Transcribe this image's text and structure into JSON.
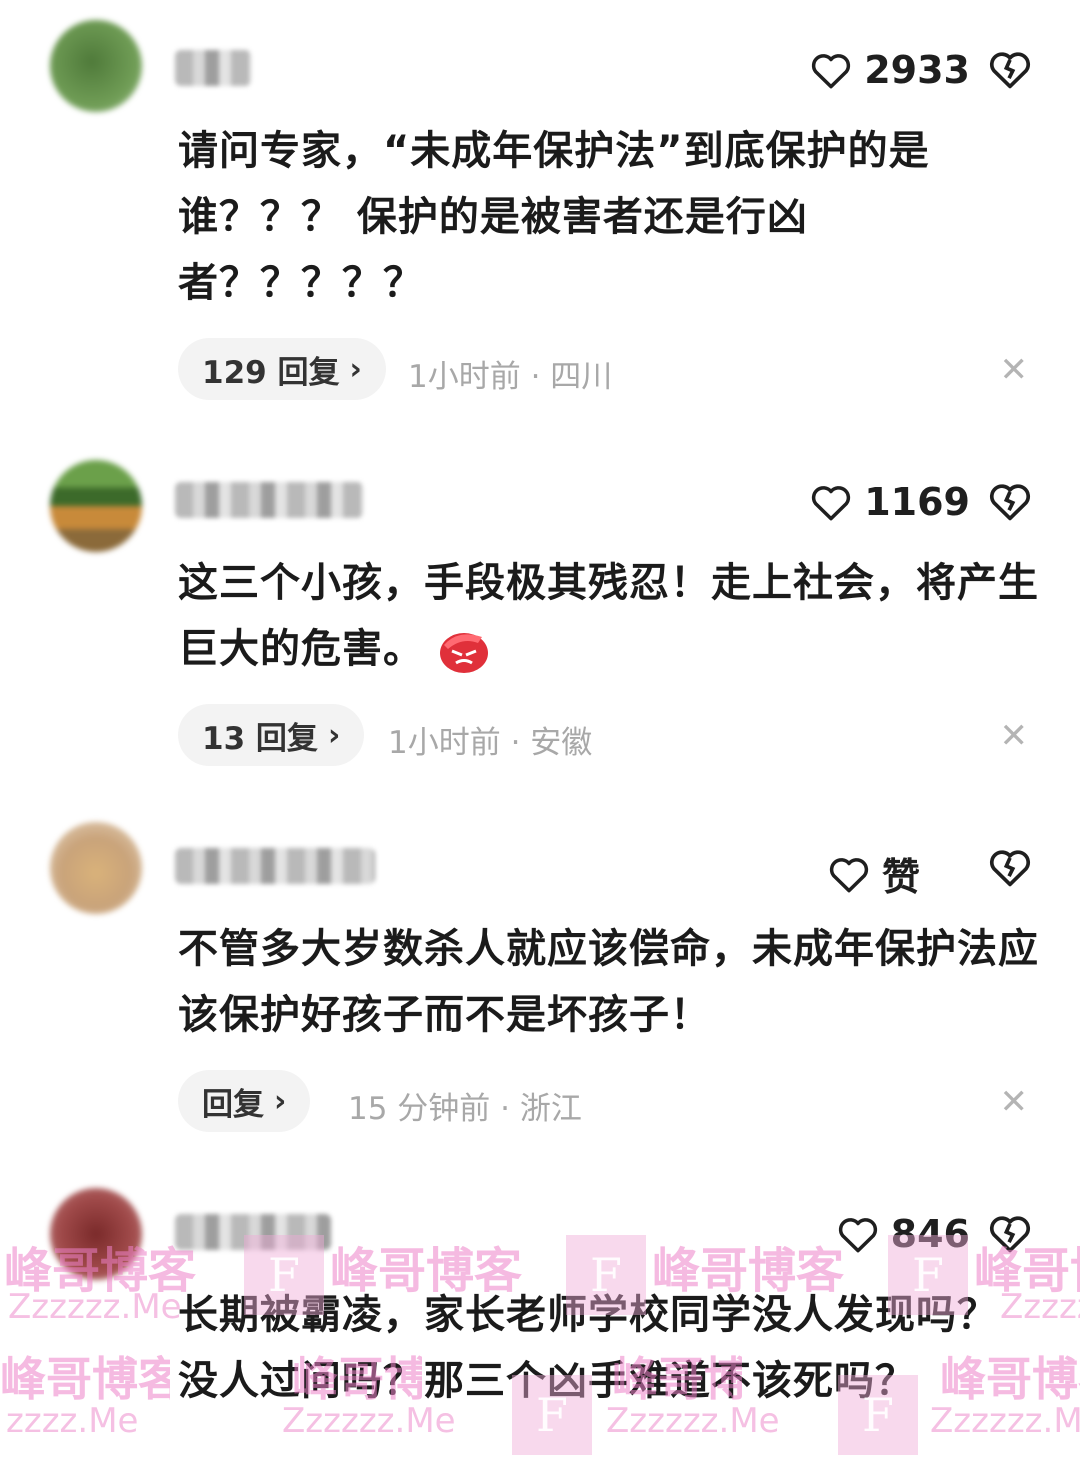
{
  "comments": [
    {
      "likes": "2933",
      "text": "请问专家，“未成年保护法”到底保护的是谁？？？ 保护的是被害者还是行凶者？？？？？",
      "reply_label": "129 回复",
      "time": "1小时前",
      "location": "四川"
    },
    {
      "likes": "1169",
      "text": "这三个小孩，手段极其残忍！走上社会，将产生巨大的危害。",
      "reply_label": "13 回复",
      "time": "1小时前",
      "location": "安徽"
    },
    {
      "likes": "赞",
      "text": "不管多大岁数杀人就应该偿命，未成年保护法应该保护好孩子而不是坏孩子！",
      "reply_label": "回复",
      "time": "15 分钟前",
      "location": "浙江"
    },
    {
      "likes": "846",
      "text": "长期被霸凌，家长老师学校同学没人发现吗？没人过问吗？那三个凶手难道不该死吗？"
    }
  ],
  "watermark": {
    "name": "峰哥博客",
    "url": "Zzzzzz.Me",
    "url_short": "zzzz.Me",
    "logo_letter": "F"
  }
}
